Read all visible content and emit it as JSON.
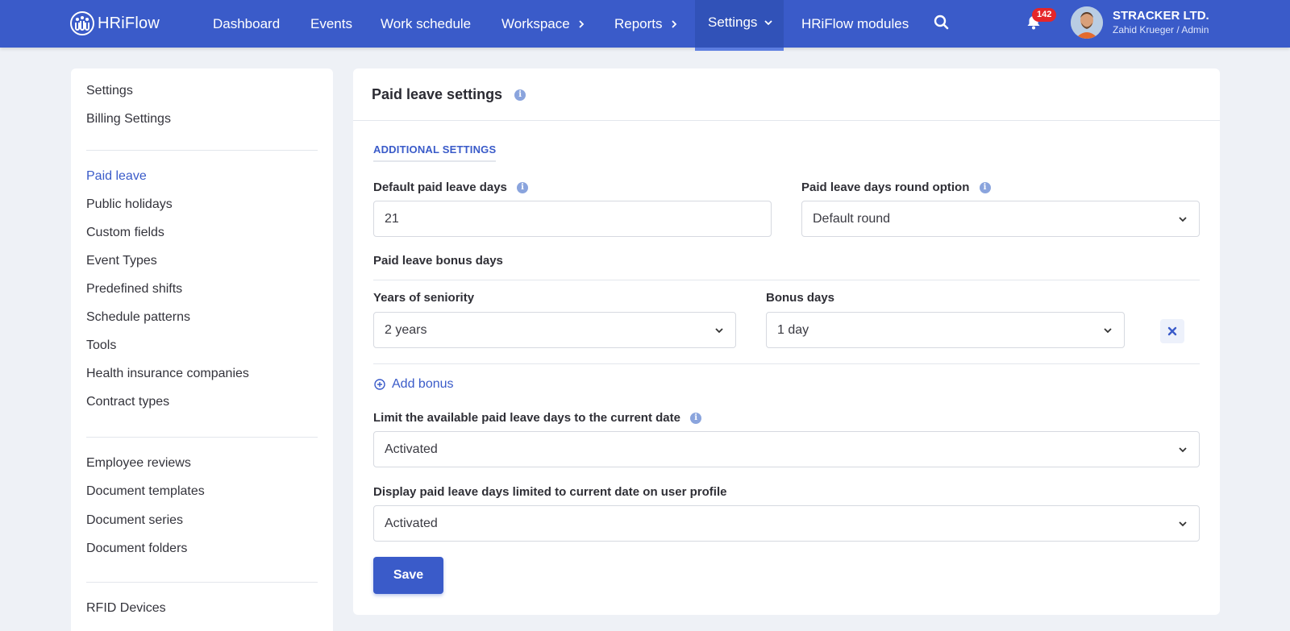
{
  "brand": {
    "name": "HRiFlow"
  },
  "nav": {
    "items": [
      {
        "label": "Dashboard",
        "has_chevron": false,
        "active": false
      },
      {
        "label": "Events",
        "has_chevron": false,
        "active": false
      },
      {
        "label": "Work schedule",
        "has_chevron": false,
        "active": false
      },
      {
        "label": "Workspace",
        "has_chevron": true,
        "active": false
      },
      {
        "label": "Reports",
        "has_chevron": true,
        "active": false
      },
      {
        "label": "Settings",
        "has_chevron": true,
        "active": true
      },
      {
        "label": "HRiFlow modules",
        "has_chevron": false,
        "active": false
      }
    ],
    "search_icon": "search-icon",
    "notifications": {
      "icon": "bell-icon",
      "count": "142"
    },
    "company": "STRACKER LTD.",
    "user": "Zahid Krueger / Admin"
  },
  "sidebar": {
    "group1": [
      "Settings",
      "Billing Settings"
    ],
    "group2": [
      "Paid leave",
      "Public holidays",
      "Custom fields",
      "Event Types",
      "Predefined shifts",
      "Schedule patterns",
      "Tools",
      "Health insurance companies",
      "Contract types"
    ],
    "group3": [
      "Employee reviews",
      "Document templates",
      "Document series",
      "Document folders"
    ],
    "group4": [
      "RFID Devices"
    ],
    "active": "Paid leave"
  },
  "main": {
    "title": "Paid leave settings",
    "section_tab": "ADDITIONAL SETTINGS",
    "default_days": {
      "label": "Default paid leave days",
      "value": "21"
    },
    "round_option": {
      "label": "Paid leave days round option",
      "value": "Default round"
    },
    "bonus_days_heading": "Paid leave bonus days",
    "seniority": {
      "label": "Years of seniority",
      "value": "2 years"
    },
    "bonus": {
      "label": "Bonus days",
      "value": "1 day"
    },
    "add_bonus_label": "Add bonus",
    "limit_current_date": {
      "label": "Limit the available paid leave days to the current date",
      "value": "Activated"
    },
    "display_limited": {
      "label": "Display paid leave days limited to current date on user profile",
      "value": "Activated"
    },
    "save_label": "Save"
  },
  "colors": {
    "primary": "#3a5bc9",
    "badge": "#e5262a",
    "background": "#eef1f6"
  }
}
